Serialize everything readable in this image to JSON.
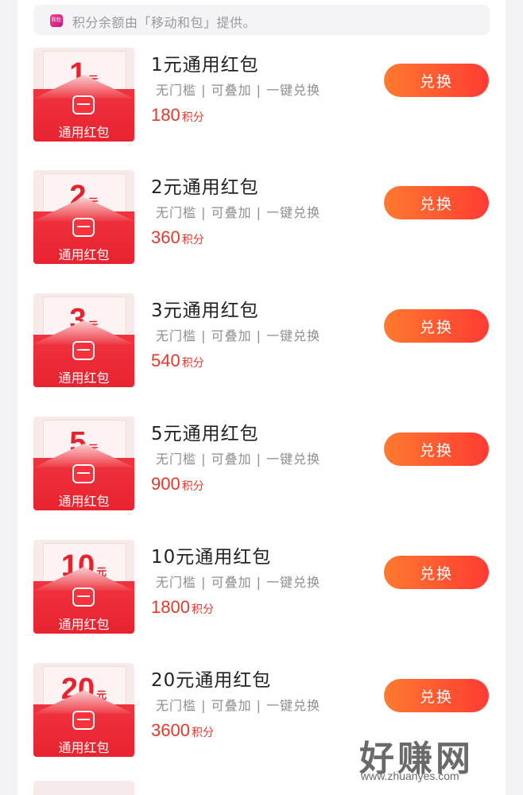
{
  "notice": {
    "badge": "和包",
    "text": "积分余额由「移动和包」提供。"
  },
  "items": [
    {
      "amount": "1",
      "unit": "元",
      "env_label": "通用红包",
      "title": "1元通用红包",
      "tags": "无门槛 | 可叠加 | 一键兑换",
      "points": "180",
      "points_unit": "积分",
      "button": "兑换"
    },
    {
      "amount": "2",
      "unit": "元",
      "env_label": "通用红包",
      "title": "2元通用红包",
      "tags": "无门槛 | 可叠加 | 一键兑换",
      "points": "360",
      "points_unit": "积分",
      "button": "兑换"
    },
    {
      "amount": "3",
      "unit": "元",
      "env_label": "通用红包",
      "title": "3元通用红包",
      "tags": "无门槛 | 可叠加 | 一键兑换",
      "points": "540",
      "points_unit": "积分",
      "button": "兑换"
    },
    {
      "amount": "5",
      "unit": "元",
      "env_label": "通用红包",
      "title": "5元通用红包",
      "tags": "无门槛 | 可叠加 | 一键兑换",
      "points": "900",
      "points_unit": "积分",
      "button": "兑换"
    },
    {
      "amount": "10",
      "unit": "元",
      "env_label": "通用红包",
      "title": "10元通用红包",
      "tags": "无门槛 | 可叠加 | 一键兑换",
      "points": "1800",
      "points_unit": "积分",
      "button": "兑换"
    },
    {
      "amount": "20",
      "unit": "元",
      "env_label": "通用红包",
      "title": "20元通用红包",
      "tags": "无门槛 | 可叠加 | 一键兑换",
      "points": "3600",
      "points_unit": "积分",
      "button": "兑换"
    }
  ],
  "watermark": {
    "main": "好赚网",
    "sub": "www.zhuanyes.com"
  },
  "colors": {
    "accent_red": "#e6232f",
    "button_start": "#ff7a2f",
    "button_end": "#ff3b34",
    "points_red": "#e33a2e"
  }
}
